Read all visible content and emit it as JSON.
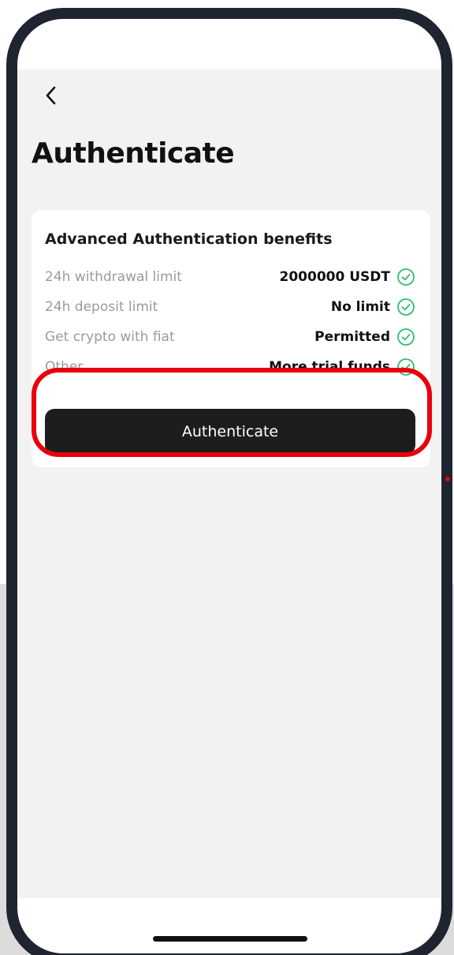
{
  "page": {
    "title": "Authenticate",
    "back_icon": "chevron-left-icon"
  },
  "card": {
    "title": "Advanced Authentication benefits",
    "rows": [
      {
        "label": "24h withdrawal limit",
        "value": "2000000 USDT",
        "icon": "check-circle-icon"
      },
      {
        "label": "24h deposit limit",
        "value": "No limit",
        "icon": "check-circle-icon"
      },
      {
        "label": "Get crypto with fiat",
        "value": "Permitted",
        "icon": "check-circle-icon"
      },
      {
        "label": "Other",
        "value": "More trial funds",
        "icon": "check-circle-icon"
      }
    ],
    "button_label": "Authenticate"
  },
  "colors": {
    "accent_green": "#2fbf71",
    "button_bg": "#1d1d1d",
    "highlight_red": "#e8000c",
    "frame": "#1f2430",
    "screen_bg": "#f2f2f2"
  }
}
